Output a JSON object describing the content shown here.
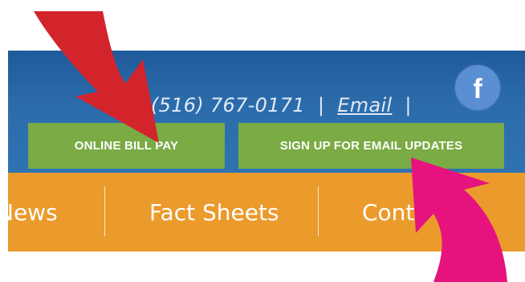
{
  "header": {
    "phone": "(516) 767-0171",
    "separator": "|",
    "email_link": "Email",
    "facebook_letter": "f"
  },
  "buttons": {
    "bill_pay": "ONLINE BILL PAY",
    "email_updates": "SIGN UP FOR EMAIL UPDATES"
  },
  "nav": {
    "items": [
      "News",
      "Fact Sheets",
      "Cont"
    ]
  },
  "colors": {
    "header_blue": "#2c6cab",
    "button_green": "#7aab44",
    "nav_orange": "#eb9a2c",
    "facebook_blue": "#5b8fd3",
    "red_arrow": "#d3242c",
    "pink_arrow": "#e6137f"
  },
  "icons": {
    "facebook": "facebook-icon",
    "red_arrow": "red-arrow-annotation",
    "pink_arrow": "pink-arrow-annotation"
  }
}
